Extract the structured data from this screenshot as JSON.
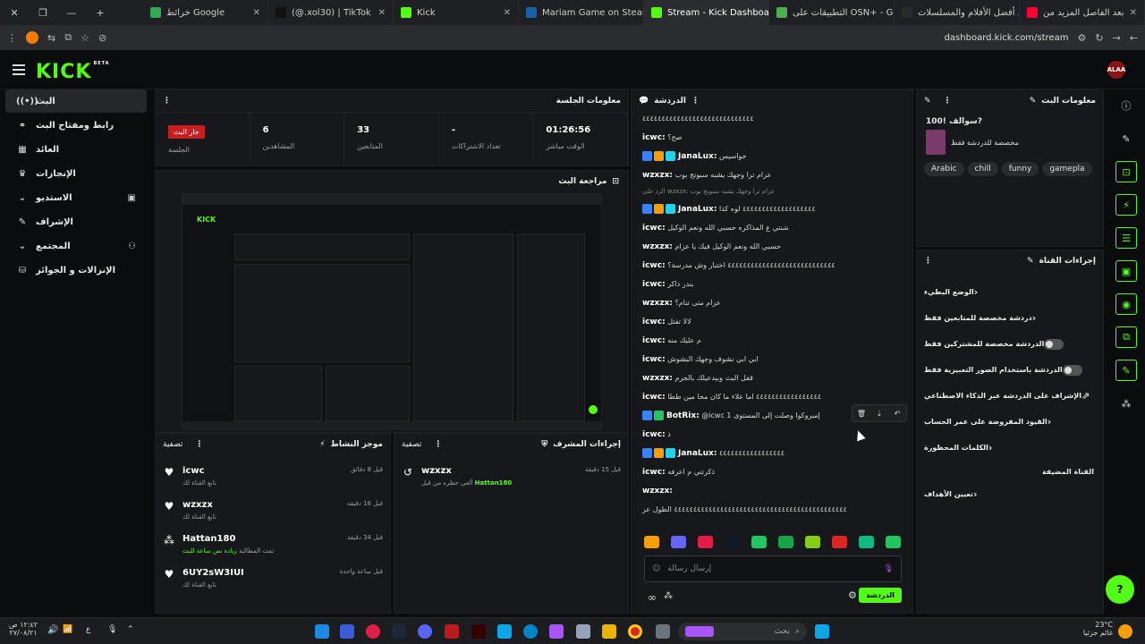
{
  "browser": {
    "tabs": [
      {
        "label": "بعد الفاصل المزيد من",
        "color": "#ff0033"
      },
      {
        "label": "شاهد أفضل الأفلام والمسلسلات",
        "color": "#2a2a2a"
      },
      {
        "label": "التطبيقات على OSN+ - Go",
        "color": "#4caf50"
      },
      {
        "label": "Stream - Kick Dashboard",
        "color": "#53fc18"
      },
      {
        "label": "Mariam Game on Steam",
        "color": "#1b5fa6"
      },
      {
        "label": "Kick",
        "color": "#53fc18"
      },
      {
        "label": "(@.xol30) | TikTok",
        "color": "#111"
      },
      {
        "label": "خرائط Google",
        "color": "#34a853"
      }
    ],
    "url": "dashboard.kick.com/stream"
  },
  "nav": {
    "logo": "KICK",
    "beta": "BETA",
    "user_initials": "ALAA"
  },
  "sidebar": {
    "items": [
      {
        "label": "البث",
        "icon": "broadcast-icon",
        "glyph": "((•))"
      },
      {
        "label": "رابط ومفتاح البث",
        "icon": "link-icon",
        "glyph": "⚭"
      },
      {
        "label": "العائد",
        "icon": "money-icon",
        "glyph": "▦"
      },
      {
        "label": "الإنجازات",
        "icon": "trophy-icon",
        "glyph": "♛"
      },
      {
        "label": "الاستديو",
        "icon": "studio-icon",
        "glyph": "⌄",
        "extra": "▣"
      },
      {
        "label": "الإشراف",
        "icon": "wrench-icon",
        "glyph": "✎"
      },
      {
        "label": "المجتمع",
        "icon": "community-icon",
        "glyph": "⌄",
        "extra": "⚇"
      },
      {
        "label": "الإنزالات و الجوائز",
        "icon": "drops-icon",
        "glyph": "⛁"
      }
    ]
  },
  "session": {
    "title": "معلومات الجلسة",
    "live_badge": "جار البث",
    "stats": [
      {
        "value": "01:26:56",
        "label": "الوقت مباشر"
      },
      {
        "value": "-",
        "label": "تعداد الاشتراكات"
      },
      {
        "value": "33",
        "label": "المتابعين"
      },
      {
        "value": "6",
        "label": "المشاهدين"
      },
      {
        "value": "",
        "label": "الجلسة"
      }
    ]
  },
  "preview": {
    "title": "مراجعة البث"
  },
  "activity": {
    "title": "موجز النشاط",
    "filter": "تصفية",
    "items": [
      {
        "name": "icwc",
        "sub": "تابع القناة لك",
        "time": "قبل 8 دقائق",
        "icon": "heart-icon",
        "glyph": "♥"
      },
      {
        "name": "wzxzx",
        "sub": "تابع القناة لك",
        "time": "قبل 16 دقيقة",
        "icon": "heart-icon",
        "glyph": "♥"
      },
      {
        "name": "Hattan180",
        "sub": "تمت المطالبة",
        "sub_hl": "زيادة نص ساعة للبث",
        "time": "قبل 34 دقيقة",
        "icon": "points-icon",
        "glyph": "⁂"
      },
      {
        "name": "6UY2sW3IUI",
        "sub": "تابع القناة لك",
        "time": "قبل ساعة واحدة",
        "icon": "heart-icon",
        "glyph": "♥"
      }
    ]
  },
  "mod": {
    "title": "إجراءات المشرف",
    "filter": "تصفية",
    "item": {
      "name": "wzxzx",
      "sub": "ألغى حظره من قبل",
      "by": "Hattan180",
      "time": "قبل 15 دقيقة"
    }
  },
  "chat": {
    "title": "الدردشة",
    "messages": [
      {
        "u": "",
        "t": "٤٤٤٤٤٤٤٤٤٤٤٤٤٤٤٤٤٤٤٤٤٤٤٤٤٤٤٤٤"
      },
      {
        "u": "icwc:",
        "t": "صح؟"
      },
      {
        "u": "JanaLux:",
        "t": "جواسيس",
        "badges": [
          "#3b82f6",
          "#f59e0b",
          "#22d3ee"
        ]
      },
      {
        "u": "wzxzx:",
        "t": "عزام ترا وجهك يشبه سبونج بوب"
      },
      {
        "u": "",
        "t": "الرد على wzxzx: عزام ترا وجهك يشبه سبونج بوب",
        "reply": true
      },
      {
        "u": "JanaLux:",
        "t": "٤٤٤٤٤٤٤٤٤٤٤٤٤٤٤٤٤٤٤ لوه كذا",
        "badges": [
          "#3b82f6",
          "#f59e0b",
          "#22d3ee"
        ]
      },
      {
        "u": "icwc:",
        "t": "شنتي ع المذاكره حسبي الله ونعم الوكيل"
      },
      {
        "u": "wzxzx:",
        "t": "حسبي الله ونعم الوكيل فيك يا عزام"
      },
      {
        "u": "icwc:",
        "t": "٤٤٤٤٤٤٤٤٤٤٤٤٤٤٤٤٤٤٤٤٤٤٤٤٤٤٤٤ اختبار وش مدرسة؟"
      },
      {
        "u": "icwc:",
        "t": "بندر ذاكر"
      },
      {
        "u": "wzxzx:",
        "t": "عزام متى تنام؟"
      },
      {
        "u": "icwc:",
        "t": "لالا تفتل"
      },
      {
        "u": "icwc:",
        "t": "م عليك منه"
      },
      {
        "u": "icwc:",
        "t": "ابي ابي نشوف وجهك البشوش"
      },
      {
        "u": "wzxzx:",
        "t": "قفل البث وبيدعيلك بالجرم"
      },
      {
        "u": "icwc:",
        "t": "٤٤٤٤٤٤٤٤٤٤٤٤٤٤٤٤٤ اما علاء ما كان محا مين ططا"
      },
      {
        "u": "BotRix:",
        "t": "@icwc 1 إمبروكوا وصلت إلى المستوى",
        "badges": [
          "#3b82f6",
          "#22c55e"
        ]
      },
      {
        "u": "icwc:",
        "t": "ذ"
      },
      {
        "u": "JanaLux:",
        "t": "٤٤٤٤٤٤٤٤٤٤٤٤٤٤٤٤٤",
        "badges": [
          "#3b82f6",
          "#f59e0b",
          "#22d3ee"
        ]
      },
      {
        "u": "icwc:",
        "t": "ذكرتني م اعرفه"
      },
      {
        "u": "wzxzx:",
        "t": ""
      },
      {
        "u": "",
        "t": "٤٤٤٤٤٤٤٤٤٤٤٤٤٤٤٤٤٤٤٤٤٤٤٤٤٤٤٤٤٤٤٤٤٤٤٤٤٤٤٤٤٤٤٤٤ الطول عز"
      }
    ],
    "emotes": [
      "#f59e0b",
      "#6366f1",
      "#e11d48",
      "#111827",
      "#22c55e",
      "#16a34a",
      "#84cc16",
      "#dc2626",
      "#10b981",
      "#22c55e"
    ],
    "input_placeholder": "إرسال رسالة",
    "send": "الدردشة"
  },
  "stream_info": {
    "title": "معلومات البث",
    "stream_title": "سوالف !100?",
    "category": "مخصصة للدردشة فقط",
    "tags": [
      "Arabic",
      "chill",
      "funny",
      "gamepla"
    ]
  },
  "channel_actions": {
    "title": "إجراءات القناة",
    "rows": [
      {
        "label": "الوضع البطيء",
        "type": "arrow"
      },
      {
        "label": "دردشة مخصصة للمتابعين فقط",
        "type": "arrow"
      },
      {
        "label": "الدردشة مخصصة للمشتركين فقط",
        "type": "toggle"
      },
      {
        "label": "الدردشة باستخدام الصور التعبيرية فقط",
        "type": "toggle"
      },
      {
        "label": "الإشراف على الدردشة عبر الذكاء الاصطناعي",
        "type": "ext"
      },
      {
        "label": "القيود المفروضة على عمر الحساب",
        "type": "arrow"
      },
      {
        "label": "الكلمات المحظورة",
        "type": "arrow"
      }
    ],
    "host_label": "القناة المضيفة",
    "target_label": "تعيين الأهداف"
  },
  "taskbar": {
    "weather_temp": "23°C",
    "weather_text": "غائم جزئيا",
    "search": "بحث",
    "time": "١٢:٤٢ ص",
    "date": "٢٧/٠٨/٢١",
    "lang": "ع"
  }
}
